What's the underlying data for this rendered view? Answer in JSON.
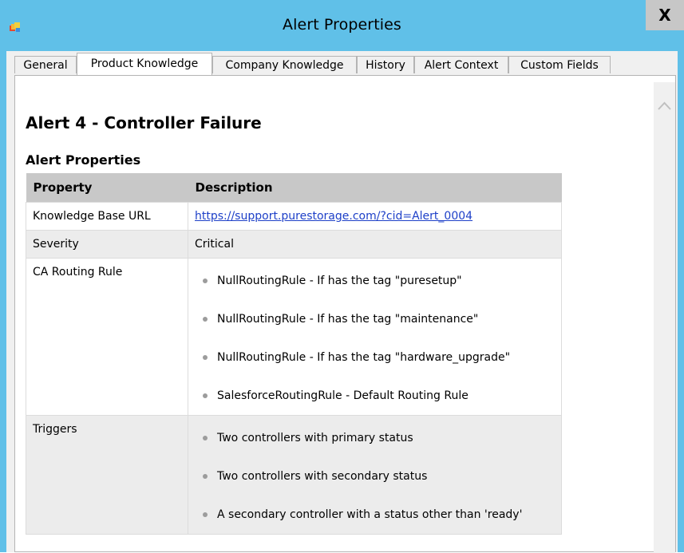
{
  "window": {
    "title": "Alert Properties",
    "close_label": "X",
    "icon": "app-window-icon"
  },
  "tabs": [
    {
      "label": "General",
      "active": false
    },
    {
      "label": "Product Knowledge",
      "active": true
    },
    {
      "label": "Company Knowledge",
      "active": false
    },
    {
      "label": "History",
      "active": false
    },
    {
      "label": "Alert Context",
      "active": false
    },
    {
      "label": "Custom Fields",
      "active": false
    }
  ],
  "content": {
    "alert_title": "Alert 4 - Controller Failure",
    "section_title": "Alert Properties",
    "table": {
      "headers": [
        "Property",
        "Description"
      ],
      "kb_label": "Knowledge Base URL",
      "kb_url": "https://support.purestorage.com/?cid=Alert_0004",
      "severity_label": "Severity",
      "severity_value": "Critical",
      "routing_label": "CA Routing Rule",
      "routing_rules": [
        "NullRoutingRule - If has the tag \"puresetup\"",
        "NullRoutingRule - If has the tag \"maintenance\"",
        "NullRoutingRule - If has the tag \"hardware_upgrade\"",
        "SalesforceRoutingRule - Default Routing Rule"
      ],
      "triggers_label": "Triggers",
      "triggers": [
        "Two controllers with primary status",
        "Two controllers with secondary status",
        "A secondary controller with a status other than 'ready'"
      ]
    }
  },
  "scrollbar": {
    "up_icon": "chevron-up-icon"
  },
  "colors": {
    "titlebar": "#60c0e8",
    "link": "#1e40c8",
    "header_row": "#c8c8c8",
    "alt_row": "#ececec"
  }
}
